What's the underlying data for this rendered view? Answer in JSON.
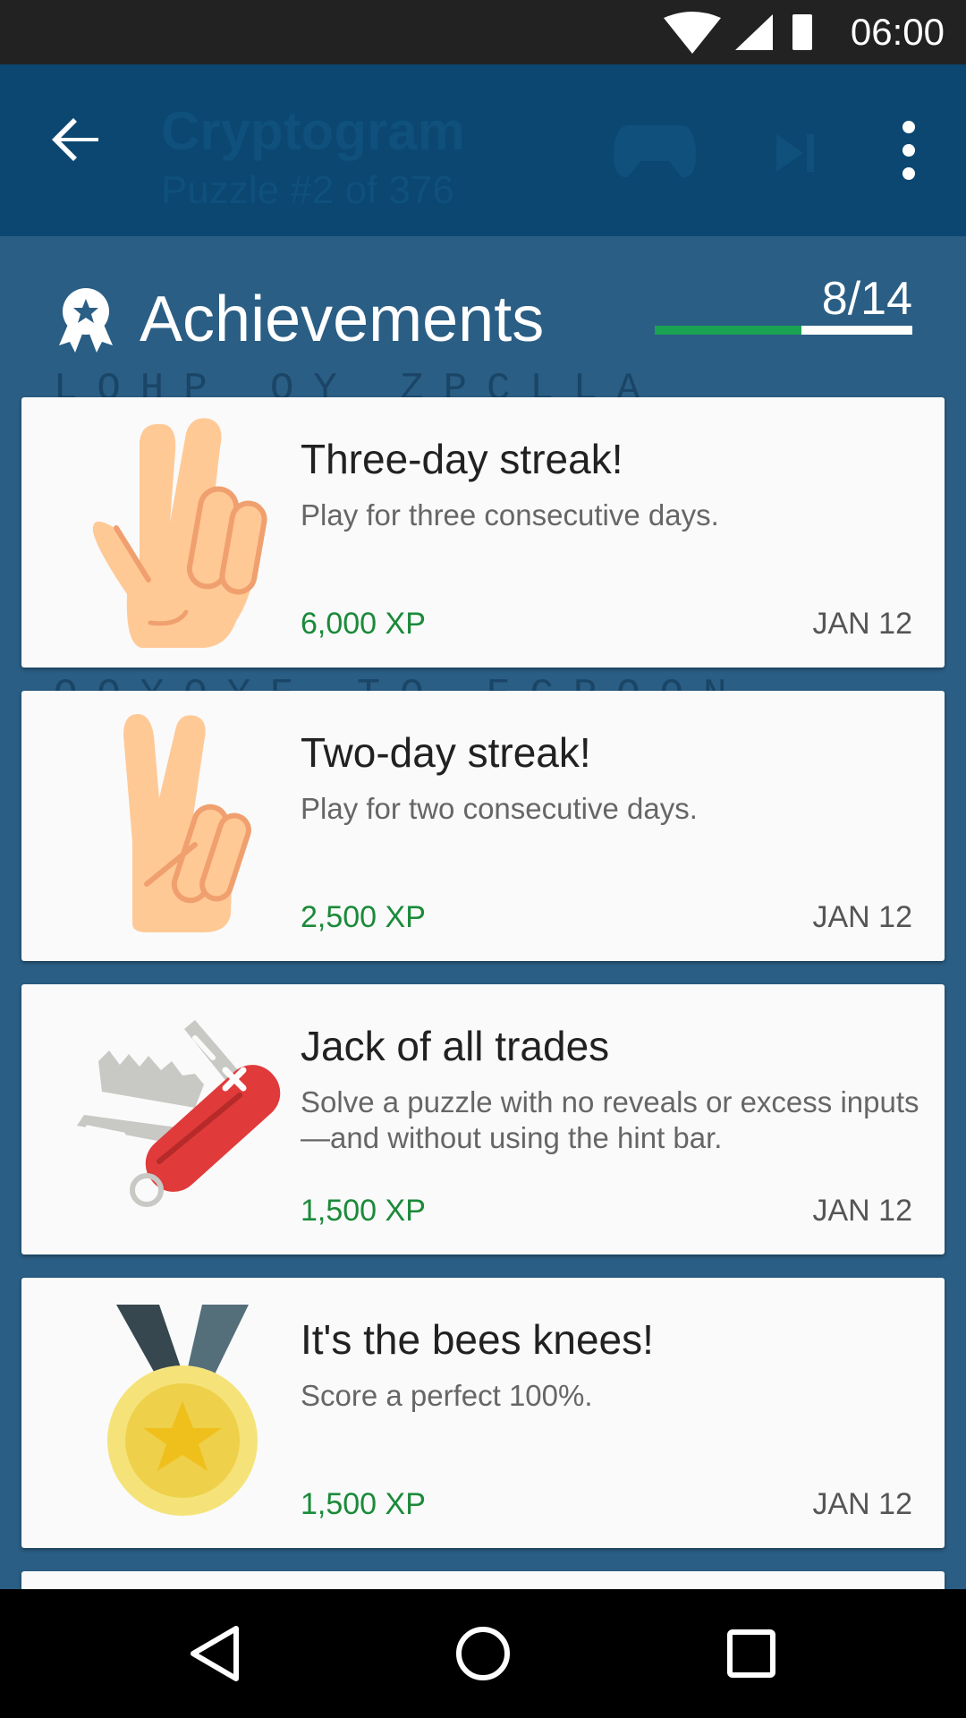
{
  "status_bar": {
    "time": "06:00"
  },
  "app_bar": {
    "title": "Cryptogram",
    "subtitle": "Puzzle #2 of 376",
    "back_icon": "arrow-back-icon",
    "menu_icon": "more-vert-icon"
  },
  "puzzle_bg": {
    "row1": "LOHP OY ZPCLLA",
    "row2": "OOYOYE TO ECPOON"
  },
  "achievements": {
    "title": "Achievements",
    "count": "8/14",
    "progress": 0.571,
    "accent": "#1aa352"
  },
  "cards": [
    {
      "title": "Three-day streak!",
      "desc": "Play for three consecutive days.",
      "xp": "6,000 XP",
      "date": "JAN 12",
      "icon": "three-fingers-hand-icon"
    },
    {
      "title": "Two-day streak!",
      "desc": "Play for two consecutive days.",
      "xp": "2,500 XP",
      "date": "JAN 12",
      "icon": "peace-hand-icon"
    },
    {
      "title": "Jack of all trades",
      "desc": "Solve a puzzle with no reveals or excess inputs—and without using the hint bar.",
      "xp": "1,500 XP",
      "date": "JAN 12",
      "icon": "swiss-army-knife-icon"
    },
    {
      "title": "It's the bees knees!",
      "desc": "Score a perfect 100%.",
      "xp": "1,500 XP",
      "date": "JAN 12",
      "icon": "gold-medal-icon"
    }
  ]
}
